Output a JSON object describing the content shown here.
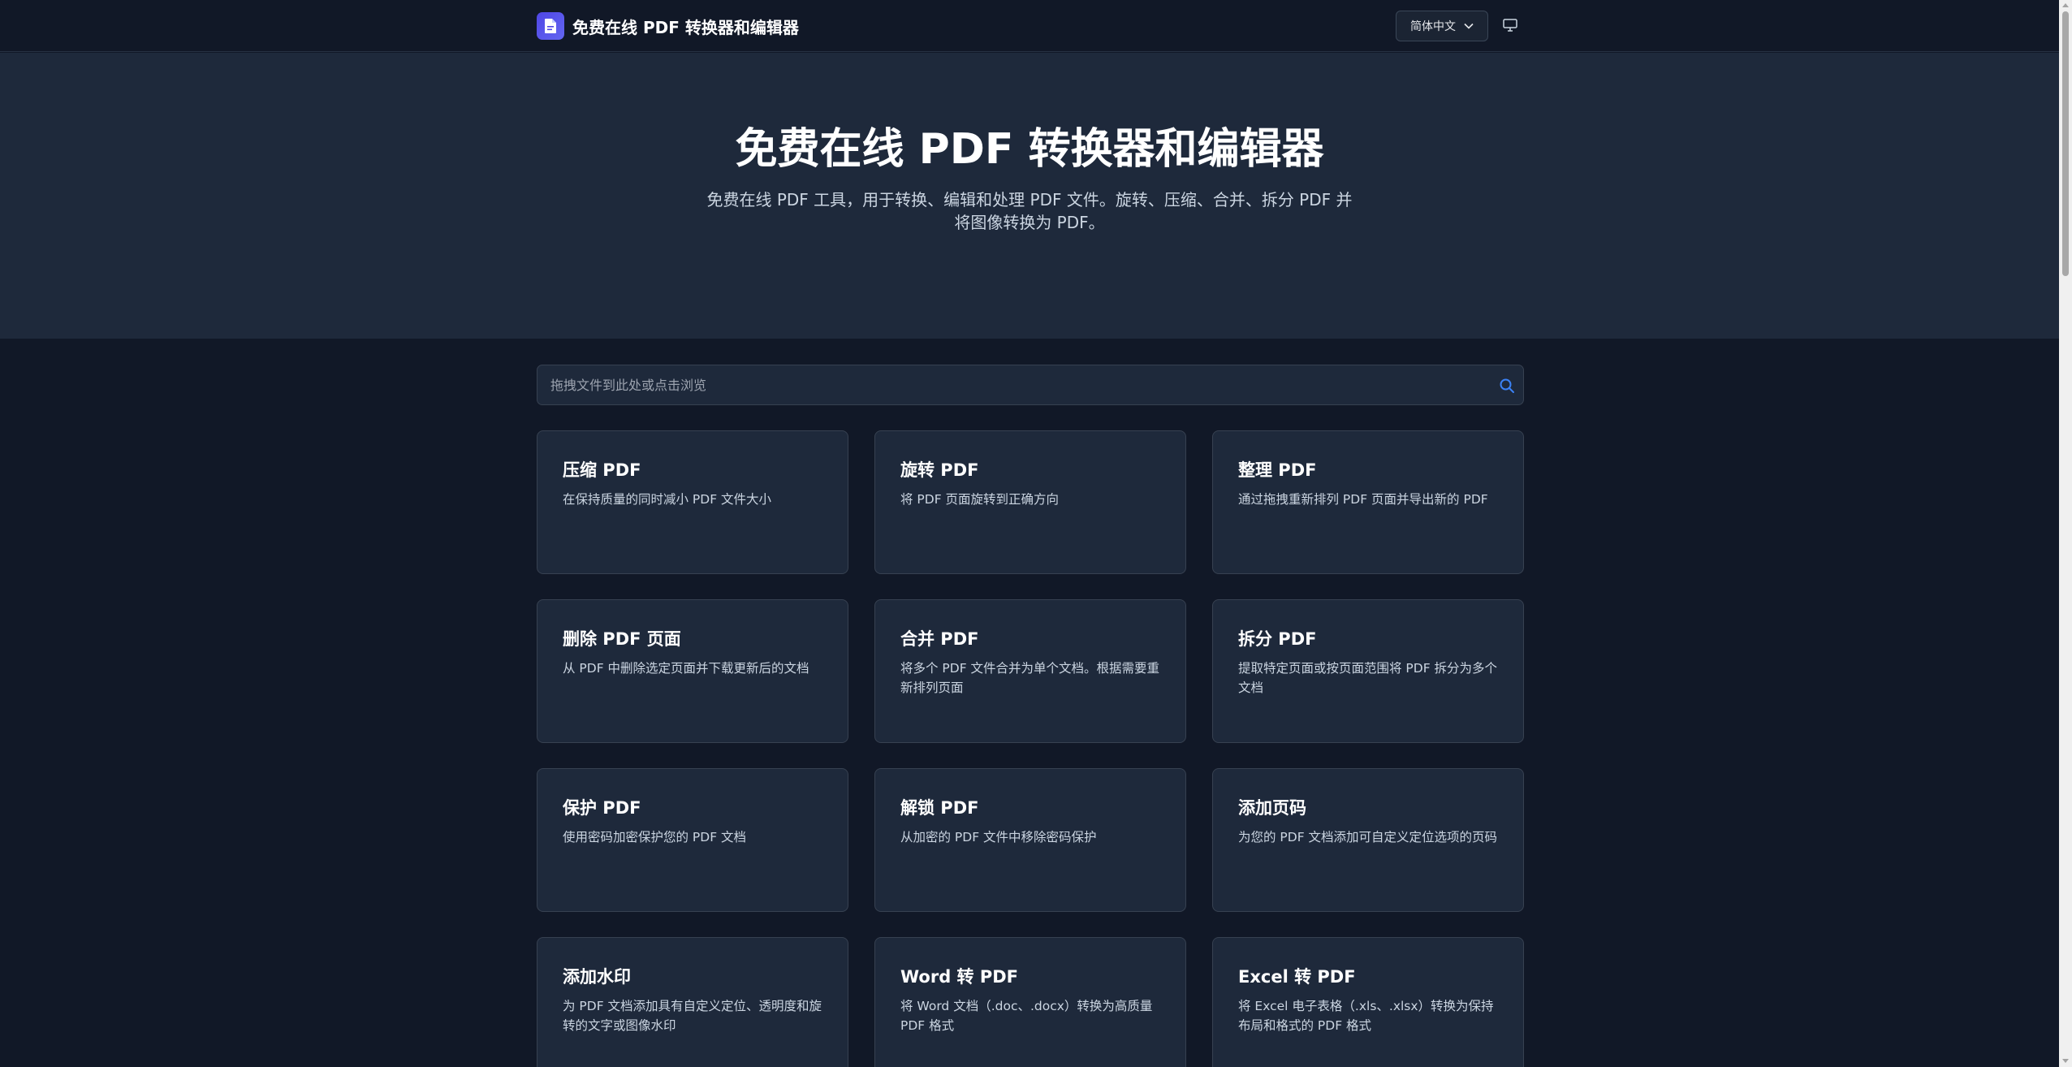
{
  "header": {
    "brand_title": "免费在线 PDF 转换器和编辑器",
    "language_label": "简体中文"
  },
  "hero": {
    "title": "免费在线 PDF 转换器和编辑器",
    "subtitle": "免费在线 PDF 工具，用于转换、编辑和处理 PDF 文件。旋转、压缩、合并、拆分 PDF 并将图像转换为 PDF。"
  },
  "search": {
    "placeholder": "拖拽文件到此处或点击浏览"
  },
  "tools": [
    {
      "title": "压缩 PDF",
      "desc": "在保持质量的同时减小 PDF 文件大小"
    },
    {
      "title": "旋转 PDF",
      "desc": "将 PDF 页面旋转到正确方向"
    },
    {
      "title": "整理 PDF",
      "desc": "通过拖拽重新排列 PDF 页面并导出新的 PDF"
    },
    {
      "title": "删除 PDF 页面",
      "desc": "从 PDF 中删除选定页面并下载更新后的文档"
    },
    {
      "title": "合并 PDF",
      "desc": "将多个 PDF 文件合并为单个文档。根据需要重新排列页面"
    },
    {
      "title": "拆分 PDF",
      "desc": "提取特定页面或按页面范围将 PDF 拆分为多个文档"
    },
    {
      "title": "保护 PDF",
      "desc": "使用密码加密保护您的 PDF 文档"
    },
    {
      "title": "解锁 PDF",
      "desc": "从加密的 PDF 文件中移除密码保护"
    },
    {
      "title": "添加页码",
      "desc": "为您的 PDF 文档添加可自定义定位选项的页码"
    },
    {
      "title": "添加水印",
      "desc": "为 PDF 文档添加具有自定义定位、透明度和旋转的文字或图像水印"
    },
    {
      "title": "Word 转 PDF",
      "desc": "将 Word 文档（.doc、.docx）转换为高质量 PDF 格式"
    },
    {
      "title": "Excel 转 PDF",
      "desc": "将 Excel 电子表格（.xls、.xlsx）转换为保持布局和格式的 PDF 格式"
    }
  ],
  "colors": {
    "background": "#111827",
    "hero_background": "#1e293b",
    "card_background": "#1e293b",
    "accent": "#4f46e5",
    "search_icon": "#3b82f6"
  },
  "icons": {
    "logo": "document-icon",
    "language_chevron": "chevron-down-icon",
    "theme": "monitor-icon",
    "search": "search-icon"
  }
}
